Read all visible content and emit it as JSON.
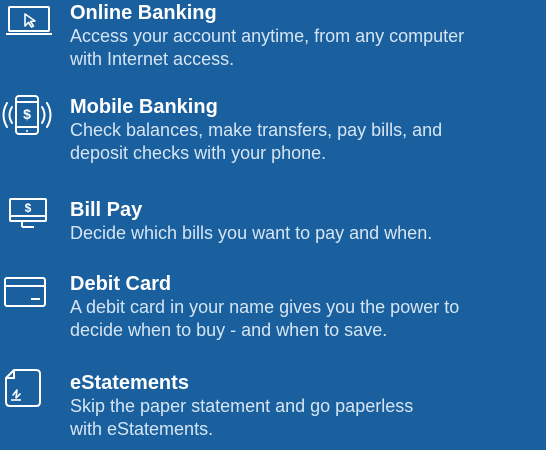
{
  "colors": {
    "background": "#1a5f9e",
    "title": "#ffffff",
    "description": "#d5e5f3",
    "icon": "#ffffff"
  },
  "features": [
    {
      "icon": "laptop-cursor-icon",
      "title": "Online Banking",
      "description_lines": [
        "Access your account anytime, from any computer",
        "with Internet access."
      ]
    },
    {
      "icon": "mobile-dollar-icon",
      "title": "Mobile Banking",
      "description_lines": [
        "Check balances, make transfers, pay bills, and",
        "deposit checks with your phone."
      ]
    },
    {
      "icon": "monitor-dollar-icon",
      "title": "Bill Pay",
      "description_lines": [
        "Decide which bills you want to pay and when."
      ]
    },
    {
      "icon": "credit-card-icon",
      "title": "Debit Card",
      "description_lines": [
        "A debit card in your name gives you the power to",
        "decide when to buy - and when to save."
      ]
    },
    {
      "icon": "document-signature-icon",
      "title": "eStatements",
      "description_lines": [
        "Skip the paper statement and go paperless",
        "with eStatements."
      ]
    }
  ]
}
